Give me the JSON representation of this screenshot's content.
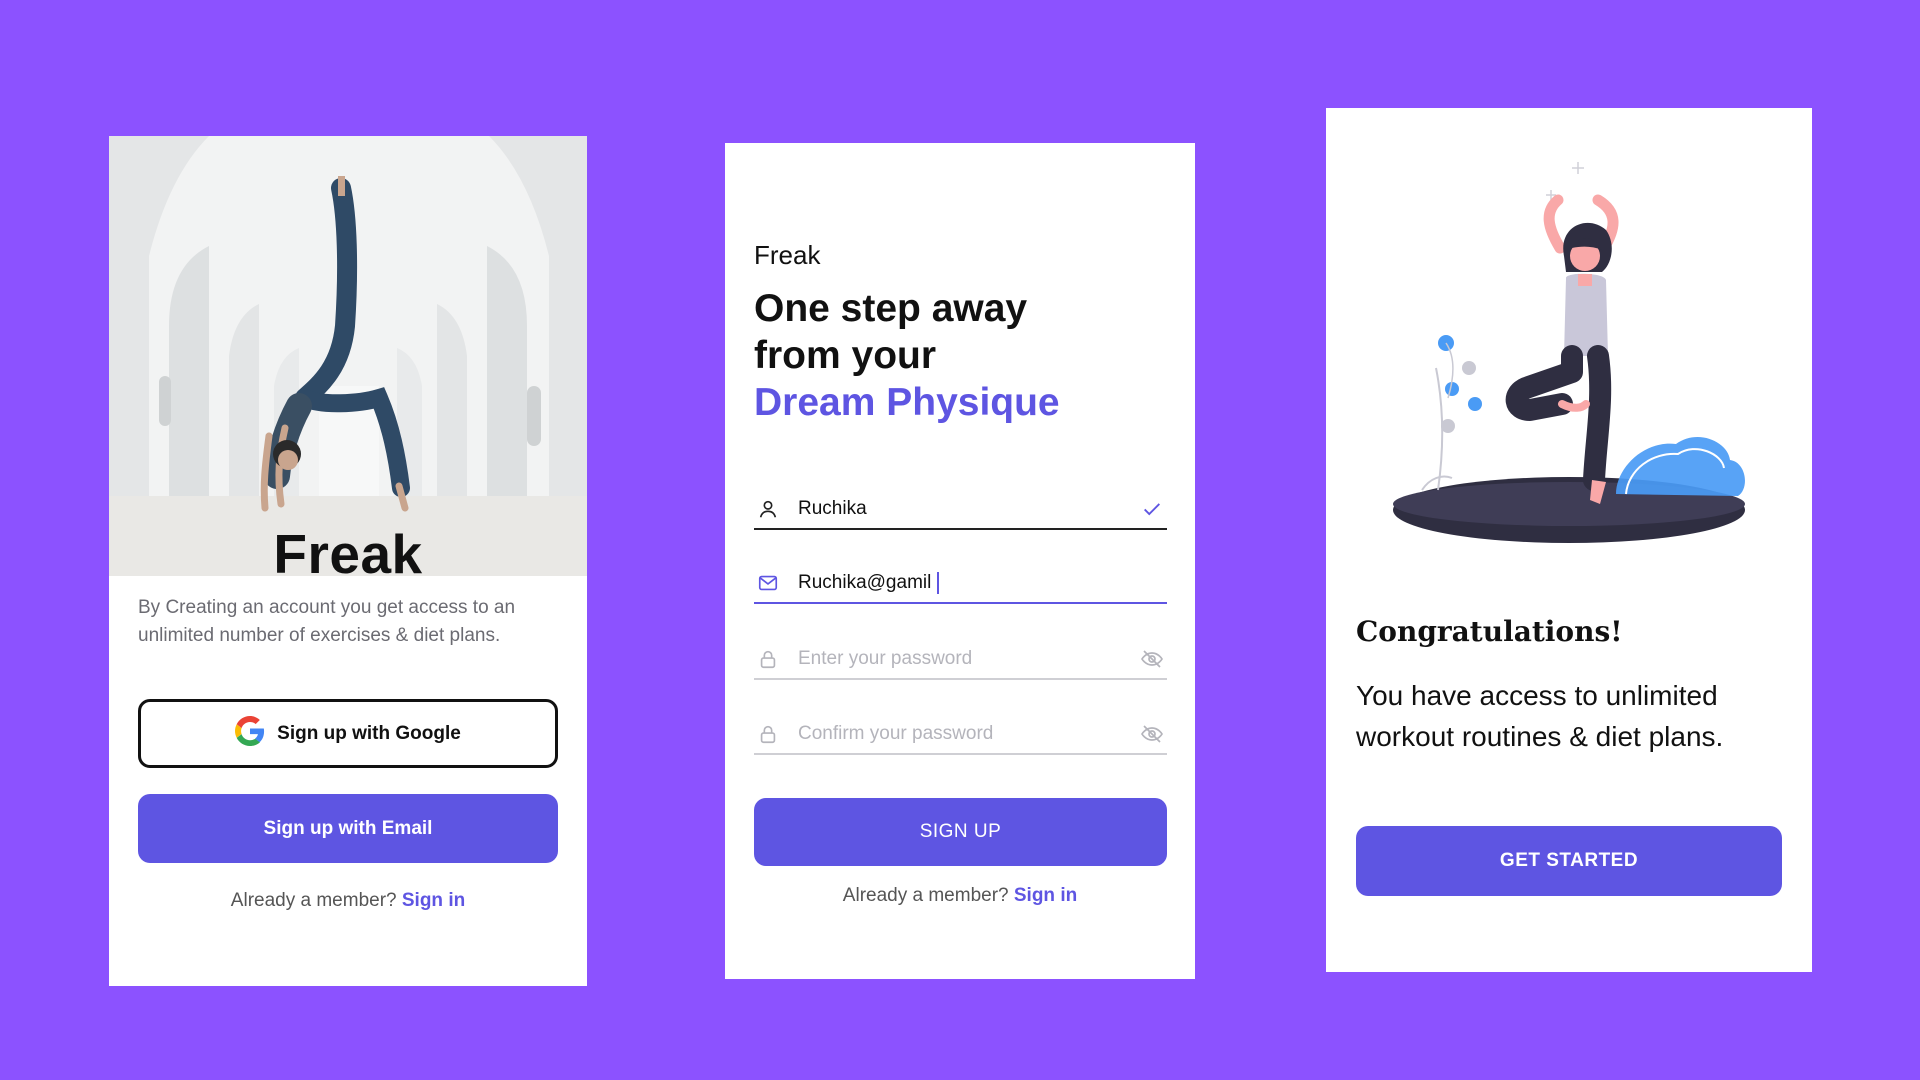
{
  "colors": {
    "background": "#8c52ff",
    "accent": "#5e55e2",
    "text": "#111111",
    "muted": "#6b6b72"
  },
  "card1": {
    "brand": "Freak",
    "description": "By Creating an account you get access to an unlimited number of exercises & diet plans.",
    "google_button": "Sign up with Google",
    "google_icon": "google-icon",
    "email_button": "Sign up with Email",
    "member_text": "Already a member?",
    "signin_link": "Sign in"
  },
  "card2": {
    "brand": "Freak",
    "headline_line1": "One step away",
    "headline_line2": "from your",
    "headline_accent": "Dream Physique",
    "fields": [
      {
        "icon": "user-icon",
        "value": "Ruchika",
        "tail_icon": "check-icon"
      },
      {
        "icon": "mail-icon",
        "value": "Ruchika@gamil"
      },
      {
        "icon": "lock-icon",
        "placeholder": "Enter your password",
        "tail_icon": "eye-off-icon"
      },
      {
        "icon": "lock-icon",
        "placeholder": "Confirm your password",
        "tail_icon": "eye-off-icon"
      }
    ],
    "signup_button": "SIGN UP",
    "member_text": "Already a member?",
    "signin_link": "Sign in"
  },
  "card3": {
    "title": "Congratulations!",
    "body": "You have access to unlimited workout routines & diet plans.",
    "start_button": "GET STARTED"
  }
}
